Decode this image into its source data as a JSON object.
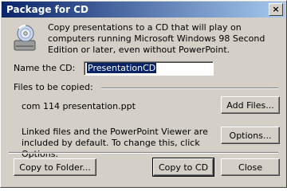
{
  "window": {
    "title": "Package for CD",
    "close_glyph": "×"
  },
  "intro": "Copy presentations to a CD that will play on computers running Microsoft Windows 98 Second Edition or later, even without PowerPoint.",
  "name_field": {
    "label": "Name the CD:",
    "value": "PresentationCD"
  },
  "files": {
    "group_label": "Files to be copied:",
    "file_name": "com 114 presentation.ppt",
    "add_files_label": "Add Files...",
    "note": "Linked files and the PowerPoint Viewer are included by default. To change this, click Options.",
    "options_label": "Options..."
  },
  "buttons": {
    "copy_folder": "Copy to Folder...",
    "copy_cd": "Copy to CD",
    "close": "Close"
  },
  "colors": {
    "titlebar_start": "#0a246a",
    "titlebar_end": "#a6caf0",
    "face": "#d4d0c8"
  },
  "icons": {
    "cd": "cd-icon"
  }
}
